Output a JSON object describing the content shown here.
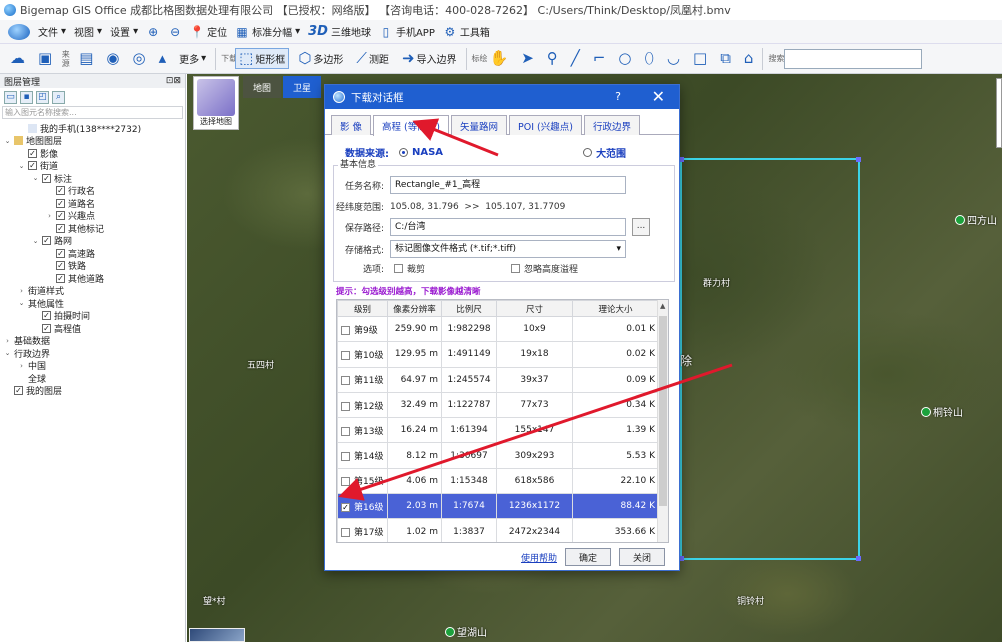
{
  "titlebar": {
    "text": "Bigemap GIS Office 成都比格图数据处理有限公司 【已授权：网络版】 【咨询电话：400-028-7262】 C:/Users/Think/Desktop/凤凰村.bmv"
  },
  "menubar": {
    "file": "文件",
    "view": "视图",
    "settings": "设置",
    "locate": "定位",
    "std_split": "标准分幅",
    "three_d": "3D",
    "three_d_globe": "三维地球",
    "mobile_app": "手机APP",
    "toolbox": "工具箱"
  },
  "toolbar": {
    "download_label": "下载",
    "more": "更多",
    "rect_frame": "矩形框",
    "polygon": "多边形",
    "measure": "测距",
    "import_border": "导入边界",
    "annotate_label": "标绘",
    "search_label": "搜索"
  },
  "layer_panel": {
    "title": "图层管理",
    "search_placeholder": "输入图元名称搜索...",
    "items": [
      {
        "label": "我的手机(138****2732)",
        "level": 1,
        "arrow": "",
        "check": false,
        "icon": "phone"
      },
      {
        "label": "地图图层",
        "level": 0,
        "arrow": "v",
        "check": false,
        "icon": "map"
      },
      {
        "label": "影像",
        "level": 1,
        "arrow": "",
        "check": true
      },
      {
        "label": "街道",
        "level": 1,
        "arrow": "v",
        "check": true
      },
      {
        "label": "标注",
        "level": 2,
        "arrow": "v",
        "check": true
      },
      {
        "label": "行政名",
        "level": 3,
        "arrow": "",
        "check": true
      },
      {
        "label": "道路名",
        "level": 3,
        "arrow": "",
        "check": true
      },
      {
        "label": "兴趣点",
        "level": 3,
        "arrow": ">",
        "check": true
      },
      {
        "label": "其他标记",
        "level": 3,
        "arrow": "",
        "check": true
      },
      {
        "label": "路网",
        "level": 2,
        "arrow": "v",
        "check": true
      },
      {
        "label": "高速路",
        "level": 3,
        "arrow": "",
        "check": true
      },
      {
        "label": "铁路",
        "level": 3,
        "arrow": "",
        "check": true
      },
      {
        "label": "其他道路",
        "level": 3,
        "arrow": "",
        "check": true
      },
      {
        "label": "街道样式",
        "level": 1,
        "arrow": ">",
        "check": null
      },
      {
        "label": "其他属性",
        "level": 1,
        "arrow": "v",
        "check": null
      },
      {
        "label": "拍摄时间",
        "level": 2,
        "arrow": "",
        "check": true
      },
      {
        "label": "高程值",
        "level": 2,
        "arrow": "",
        "check": true
      },
      {
        "label": "基础数据",
        "level": 0,
        "arrow": ">",
        "check": null
      },
      {
        "label": "行政边界",
        "level": 0,
        "arrow": "v",
        "check": null
      },
      {
        "label": "中国",
        "level": 1,
        "arrow": ">",
        "check": null
      },
      {
        "label": "全球",
        "level": 1,
        "arrow": "",
        "check": null
      },
      {
        "label": "我的图层",
        "level": 0,
        "arrow": "",
        "check": true
      }
    ]
  },
  "map": {
    "tab_map": "地图",
    "tab_satellite": "卫星",
    "basemap_selector": "选择地图",
    "places": {
      "p1": "四方山",
      "p2": "群力村",
      "p3": "五四村",
      "p4": "桐铃山",
      "p5": "望湖山",
      "p6": "铜铃村",
      "p7": "望*村",
      "p8": "除"
    }
  },
  "dialog": {
    "title": "下载对话框",
    "help_icon": "?",
    "close_icon": "✕",
    "tabs": [
      "影 像",
      "高程 (等高线)",
      "矢量路网",
      "POI (兴趣点)",
      "行政边界"
    ],
    "active_tab": 1,
    "source_label": "数据来源:",
    "source_options": [
      "NASA",
      "大范围"
    ],
    "source_selected": 0,
    "basic_info": "基本信息",
    "task_name_label": "任务名称:",
    "task_name": "Rectangle_#1_高程",
    "latlon_label": "经纬度范围:",
    "latlon_range": "105.08, 31.796  >>  105.107, 31.7709",
    "save_path_label": "保存路径:",
    "save_path": "C:/台湾",
    "browse": "...",
    "format_label": "存储格式:",
    "format_value": "标记图像文件格式 (*.tif;*.tiff)",
    "options_label": "选项:",
    "opt_clip": "裁剪",
    "opt_ignore": "忽略高度溢程",
    "tip": "提示：勾选级别越高，下载影像越清晰",
    "columns": [
      "级别",
      "像素分辨率",
      "比例尺",
      "尺寸",
      "理论大小"
    ],
    "rows": [
      {
        "level": "第9级",
        "res": "259.90",
        "unit": "m",
        "scale": "1:982298",
        "size": "10x9",
        "est": "0.01 K",
        "checked": false
      },
      {
        "level": "第10级",
        "res": "129.95",
        "unit": "m",
        "scale": "1:491149",
        "size": "19x18",
        "est": "0.02 K",
        "checked": false
      },
      {
        "level": "第11级",
        "res": "64.97",
        "unit": "m",
        "scale": "1:245574",
        "size": "39x37",
        "est": "0.09 K",
        "checked": false
      },
      {
        "level": "第12级",
        "res": "32.49",
        "unit": "m",
        "scale": "1:122787",
        "size": "77x73",
        "est": "0.34 K",
        "checked": false
      },
      {
        "level": "第13级",
        "res": "16.24",
        "unit": "m",
        "scale": "1:61394",
        "size": "155x147",
        "est": "1.39 K",
        "checked": false
      },
      {
        "level": "第14级",
        "res": "8.12",
        "unit": "m",
        "scale": "1:30697",
        "size": "309x293",
        "est": "5.53 K",
        "checked": false
      },
      {
        "level": "第15级",
        "res": "4.06",
        "unit": "m",
        "scale": "1:15348",
        "size": "618x586",
        "est": "22.10 K",
        "checked": false
      },
      {
        "level": "第16级",
        "res": "2.03",
        "unit": "m",
        "scale": "1:7674",
        "size": "1236x1172",
        "est": "88.42 K",
        "checked": true
      },
      {
        "level": "第17级",
        "res": "1.02",
        "unit": "m",
        "scale": "1:3837",
        "size": "2472x2344",
        "est": "353.66 K",
        "checked": false
      }
    ],
    "help_link": "使用帮助",
    "ok": "确定",
    "close": "关闭"
  },
  "colors": {
    "accent": "#1f5fd0",
    "selection": "#4a62d6",
    "tip": "#9a1ad0",
    "arrow": "#e0192c",
    "rect": "#3bd3e6"
  }
}
